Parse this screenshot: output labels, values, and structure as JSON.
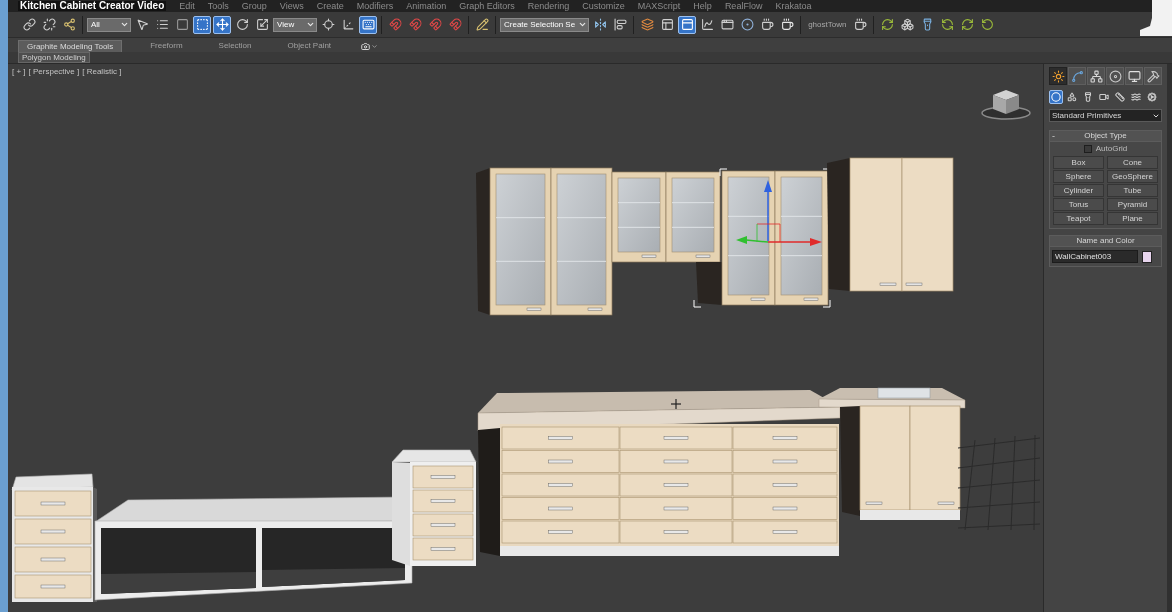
{
  "window": {
    "title": "Kitchen Cabinet Creator Video"
  },
  "menu_bar": [
    "Edit",
    "Tools",
    "Group",
    "Views",
    "Create",
    "Modifiers",
    "Animation",
    "Graph Editors",
    "Rendering",
    "Customize",
    "MAXScript",
    "Help",
    "RealFlow",
    "Krakatoa"
  ],
  "main_toolbar": {
    "items": [
      {
        "kind": "link",
        "selected": false
      },
      {
        "kind": "unlink",
        "selected": false
      },
      {
        "kind": "bind",
        "selected": false
      },
      {
        "kind": "dropdown",
        "value": "All"
      },
      {
        "kind": "select-object",
        "selected": false
      },
      {
        "kind": "select-by-name",
        "selected": false
      },
      {
        "kind": "region",
        "selected": false
      },
      {
        "kind": "window-crossing",
        "selected": true
      },
      {
        "kind": "move",
        "selected": true
      },
      {
        "kind": "rotate",
        "selected": false
      },
      {
        "kind": "scale",
        "selected": false
      },
      {
        "kind": "dropdown",
        "value": "View"
      },
      {
        "kind": "pivot",
        "selected": false
      },
      {
        "kind": "manipulate",
        "selected": false
      },
      {
        "kind": "shortcut",
        "selected": true
      },
      {
        "kind": "snap",
        "selected": false
      },
      {
        "kind": "angle-snap",
        "selected": false
      },
      {
        "kind": "percent-snap",
        "selected": false
      },
      {
        "kind": "spinner-snap",
        "selected": false
      },
      {
        "kind": "named-sets",
        "selected": false
      },
      {
        "kind": "dropdown",
        "value": "Create Selection Se"
      },
      {
        "kind": "mirror",
        "selected": false
      },
      {
        "kind": "align",
        "selected": false
      },
      {
        "kind": "layers",
        "selected": false
      },
      {
        "kind": "layer-manager",
        "selected": false
      },
      {
        "kind": "ribbon",
        "selected": true
      },
      {
        "kind": "curve-editor",
        "selected": false
      },
      {
        "kind": "schematic",
        "selected": false
      },
      {
        "kind": "material-editor",
        "selected": false
      },
      {
        "kind": "render-setup",
        "selected": false
      },
      {
        "kind": "frame-window",
        "selected": false
      },
      {
        "kind": "label",
        "text": "ghostTown"
      },
      {
        "kind": "render",
        "selected": false
      },
      {
        "kind": "plugin-window",
        "selected": false
      },
      {
        "kind": "plugin-cubes",
        "selected": false
      },
      {
        "kind": "plugin-light",
        "selected": false
      },
      {
        "kind": "plugin-prev",
        "selected": false
      },
      {
        "kind": "plugin-play",
        "selected": false
      },
      {
        "kind": "plugin-next",
        "selected": false
      }
    ]
  },
  "ribbon": {
    "tabs": [
      {
        "label": "Graphite Modeling Tools",
        "selected": true
      },
      {
        "label": "Freeform",
        "selected": false
      },
      {
        "label": "Selection",
        "selected": false
      },
      {
        "label": "Object Paint",
        "selected": false
      }
    ],
    "panel": "Polygon Modeling"
  },
  "viewport": {
    "labels": [
      "[ + ]",
      "[ Perspective ]",
      "[ Realistic ]"
    ]
  },
  "command_panel": {
    "tabs": [
      {
        "kind": "create",
        "selected": true
      },
      {
        "kind": "modify",
        "selected": false
      },
      {
        "kind": "hierarchy",
        "selected": false
      },
      {
        "kind": "motion",
        "selected": false
      },
      {
        "kind": "display",
        "selected": false
      },
      {
        "kind": "utilities",
        "selected": false
      }
    ],
    "categories": [
      {
        "kind": "geometry",
        "selected": true
      },
      {
        "kind": "shapes",
        "selected": false
      },
      {
        "kind": "lights",
        "selected": false
      },
      {
        "kind": "cameras",
        "selected": false
      },
      {
        "kind": "helpers",
        "selected": false
      },
      {
        "kind": "space-warps",
        "selected": false
      },
      {
        "kind": "systems",
        "selected": false
      }
    ],
    "object_class": "Standard Primitives",
    "object_type": {
      "toggle": "-",
      "title": "Object Type",
      "autogrid": {
        "label": "AutoGrid",
        "checked": false
      },
      "buttons": [
        "Box",
        "Cone",
        "Sphere",
        "GeoSphere",
        "Cylinder",
        "Tube",
        "Torus",
        "Pyramid",
        "Teapot",
        "Plane"
      ]
    },
    "name_and_color": {
      "title": "Name and Color",
      "name": "WallCabinet003",
      "color": "#e8d5ee"
    }
  }
}
